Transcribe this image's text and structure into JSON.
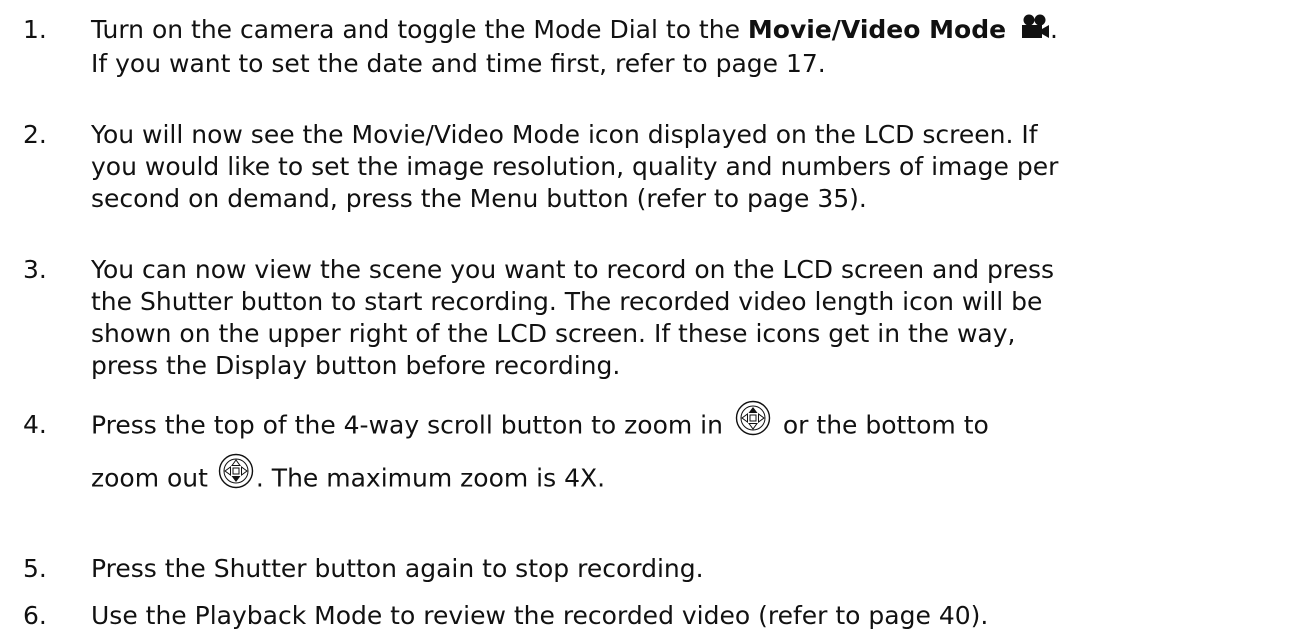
{
  "steps": [
    {
      "number": "1.",
      "line1_pre": "Turn on the camera and toggle the Mode Dial to the ",
      "line1_bold": "Movie/Video Mode",
      "line1_post": ".",
      "line2": "If you want to set the date and time first, refer to page 17.",
      "icon": "movie-camera-icon"
    },
    {
      "number": "2.",
      "lines": [
        "You will now see the Movie/Video Mode icon displayed on the LCD screen. If",
        "you would like to set the image resolution, quality and numbers of image per",
        "second on demand, press the Menu button (refer to page 35)."
      ]
    },
    {
      "number": "3.",
      "lines": [
        "You can now view the scene you want to record on the LCD screen and press",
        "the Shutter button to start recording. The recorded video length icon will be",
        "shown on the upper right of the LCD screen. If these icons get in the way,",
        "press the Display button before recording."
      ]
    },
    {
      "number": "4.",
      "line1_pre": "Press the top of the 4-way scroll button to zoom in ",
      "line1_post": " or the bottom to",
      "line2_pre": "zoom out ",
      "line2_post": ". The maximum zoom is 4X.",
      "icon_in": "dpad-up-icon",
      "icon_out": "dpad-down-icon"
    },
    {
      "number": "5.",
      "lines": [
        "Press the Shutter button again to stop recording."
      ]
    },
    {
      "number": "6.",
      "lines": [
        "Use the Playback Mode to review the recorded video (refer to page 40)."
      ]
    }
  ]
}
